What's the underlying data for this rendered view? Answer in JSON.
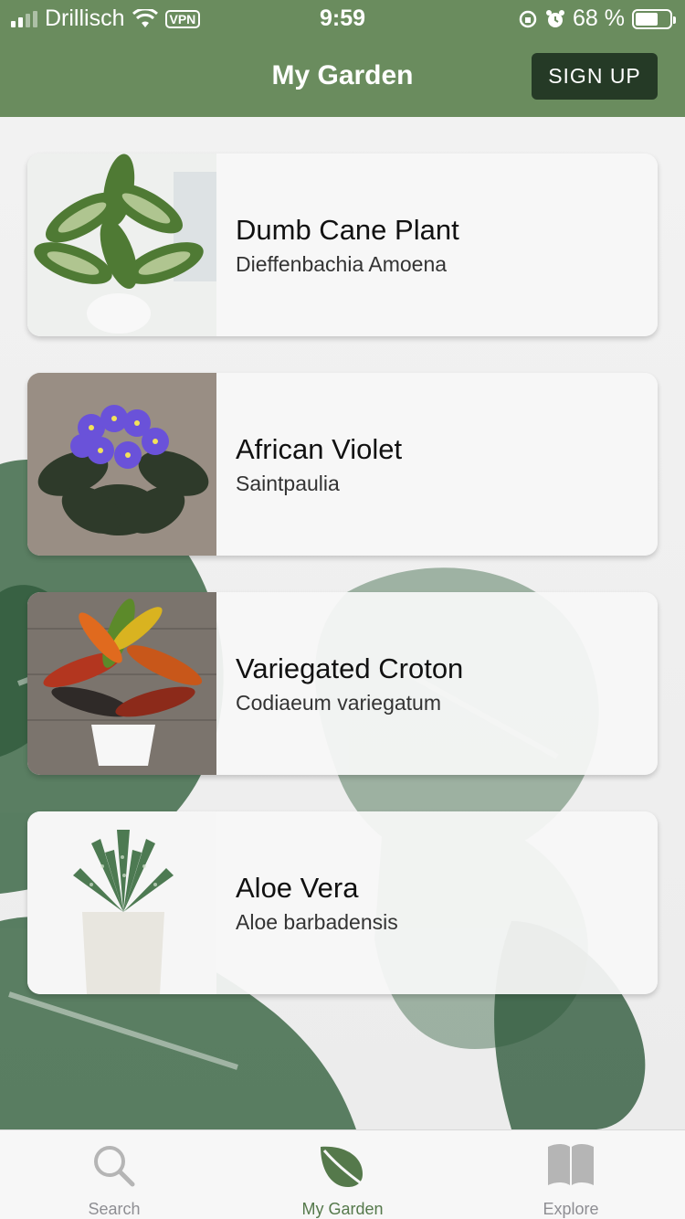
{
  "status_bar": {
    "carrier": "Drillisch",
    "vpn": "VPN",
    "time": "9:59",
    "battery": "68 %",
    "battery_level": 0.68
  },
  "header": {
    "title": "My Garden",
    "signup_label": "SIGN UP",
    "background_color": "#6a8c5e",
    "signup_color": "#253a26"
  },
  "plants": [
    {
      "name": "Dumb Cane Plant",
      "scientific": "Dieffenbachia Amoena",
      "icon": "dieffenbachia-photo"
    },
    {
      "name": "African Violet",
      "scientific": "Saintpaulia",
      "icon": "african-violet-photo"
    },
    {
      "name": "Variegated Croton",
      "scientific": "Codiaeum variegatum",
      "icon": "croton-photo"
    },
    {
      "name": "Aloe Vera",
      "scientific": "Aloe barbadensis",
      "icon": "aloe-vera-photo"
    }
  ],
  "tabs": [
    {
      "label": "Search",
      "icon": "search-icon",
      "active": false
    },
    {
      "label": "My Garden",
      "icon": "leaf-icon",
      "active": true
    },
    {
      "label": "Explore",
      "icon": "book-icon",
      "active": false
    }
  ],
  "colors": {
    "accent": "#55794b",
    "inactive": "#8e8e93"
  }
}
